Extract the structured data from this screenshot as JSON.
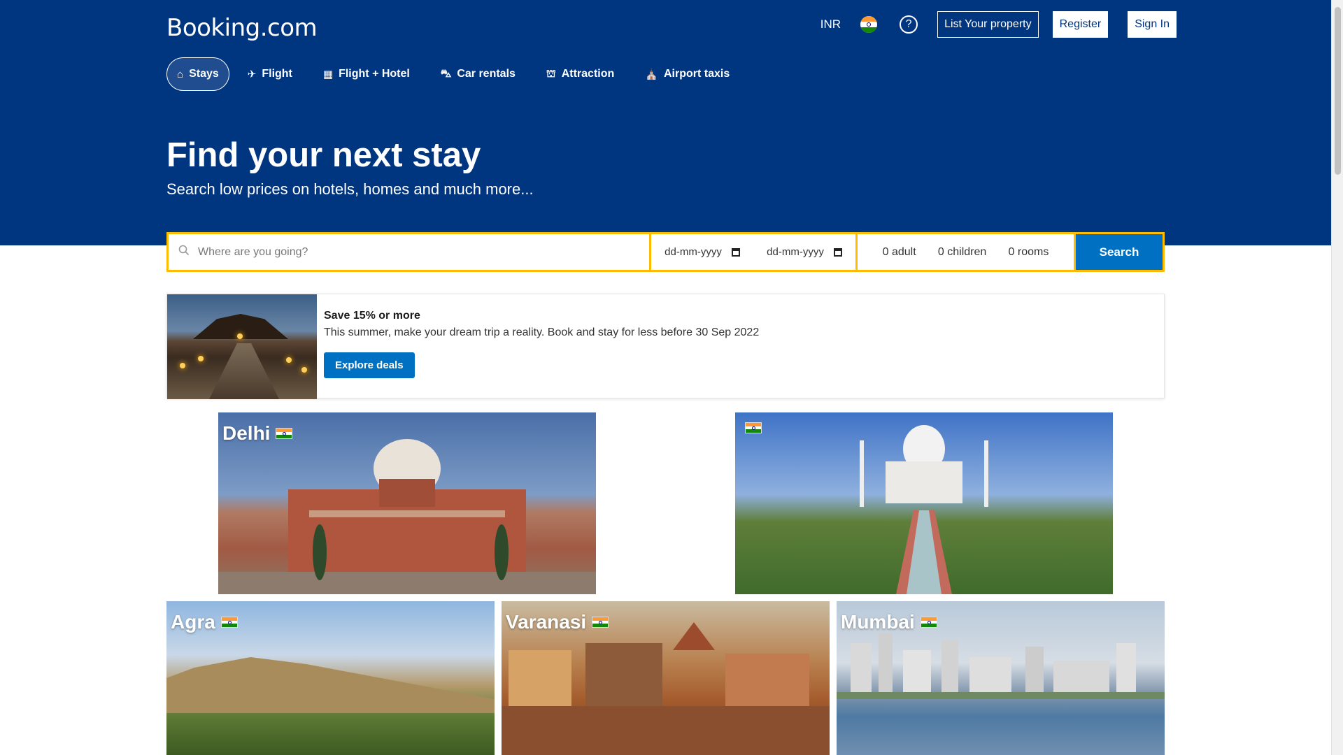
{
  "header": {
    "logo": "Booking.com",
    "currency": "INR",
    "help_icon": "?",
    "list_property": "List Your property",
    "register": "Register",
    "sign_in": "Sign In"
  },
  "nav": {
    "items": [
      {
        "label": "Stays",
        "icon": "home-icon"
      },
      {
        "label": "Flight",
        "icon": "plane-icon"
      },
      {
        "label": "Flight + Hotel",
        "icon": "building-icon"
      },
      {
        "label": "Car rentals",
        "icon": "car-icon"
      },
      {
        "label": "Attraction",
        "icon": "attraction-icon"
      },
      {
        "label": "Airport taxis",
        "icon": "taxi-icon"
      }
    ]
  },
  "hero": {
    "title": "Find your next stay",
    "subtitle": "Search low prices on hotels, homes and much more..."
  },
  "search": {
    "destination_placeholder": "Where are you going?",
    "checkin": "dd-mm-yyyy",
    "checkout": "dd-mm-yyyy",
    "adults": "0 adult",
    "children": "0 children",
    "rooms": "0 rooms",
    "button": "Search"
  },
  "promo": {
    "title": "Save 15% or more",
    "text": "This summer, make your dream trip a reality. Book and stay for less before 30 Sep 2022",
    "button": "Explore deals"
  },
  "destinations": [
    {
      "name": "Delhi"
    },
    {
      "name": ""
    },
    {
      "name": "Agra"
    },
    {
      "name": "Varanasi"
    },
    {
      "name": "Mumbai"
    }
  ],
  "colors": {
    "brand": "#003580",
    "search_border": "#febb02",
    "button": "#0071c2"
  }
}
